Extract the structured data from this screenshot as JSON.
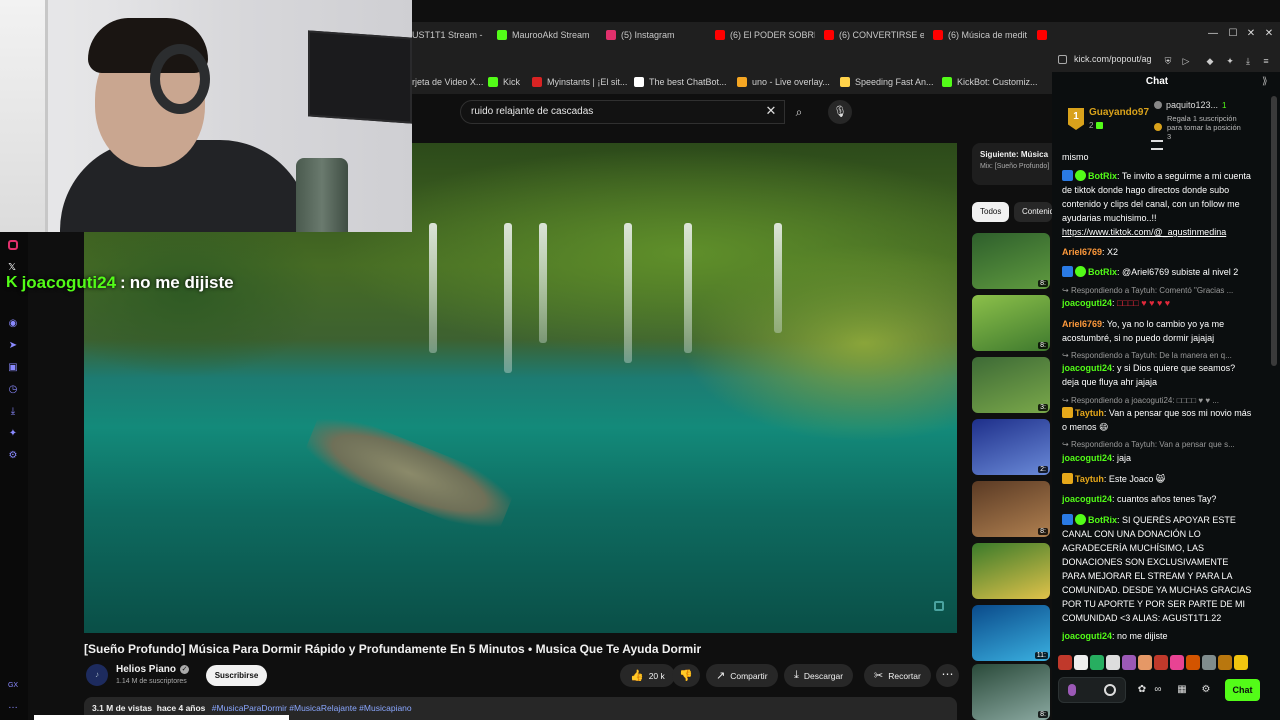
{
  "tabs": [
    {
      "label": "UST1T1 Stream - ",
      "color": "#53fc18"
    },
    {
      "label": "MaurooAkd Stream",
      "color": "#53fc18"
    },
    {
      "label": "(5) Instagram",
      "color": "#e1306c"
    },
    {
      "label": "(6) El PODER SOBRE",
      "color": "#ff0000"
    },
    {
      "label": "(6) CONVERTIRSE e",
      "color": "#ff0000"
    },
    {
      "label": "(6) Música de medit",
      "color": "#ff0000"
    }
  ],
  "bookmarks": [
    {
      "label": "rjeta de Video X...",
      "color": "#888888"
    },
    {
      "label": "Kick",
      "color": "#53fc18"
    },
    {
      "label": "Myinstants | ¡El sit...",
      "color": "#d92323"
    },
    {
      "label": "The best ChatBot...",
      "color": "#ffffff"
    },
    {
      "label": "uno - Live overlay...",
      "color": "#f5a623"
    },
    {
      "label": "Speeding Fast An...",
      "color": "#ffd24a"
    },
    {
      "label": "KickBot: Customiz...",
      "color": "#53fc18"
    }
  ],
  "chat_url": "kick.com/popout/ag",
  "search": {
    "query": "ruido relajante de cascadas"
  },
  "overlay": {
    "user": "joacoguti24",
    "sep": ":",
    "text": "no me dijiste"
  },
  "video": {
    "title": "[Sueño Profundo] Música Para Dormir Rápido y Profundamente En 5 Minutos • Musica Que Te Ayuda Dormir",
    "channel": "Helios Piano",
    "subscribers": "1.14 M de suscriptores",
    "subscribe_label": "Suscribirse",
    "likes": "20 k",
    "share_label": "Compartir",
    "download_label": "Descargar",
    "clip_label": "Recortar",
    "views": "3.1 M de vistas",
    "age": "hace 4 años",
    "tags": "#MusicaParaDormir #MusicaRelajante #Musicapiano"
  },
  "up_next": {
    "label": "Siguiente: Música",
    "sub": "Mix: [Sueño Profundo]"
  },
  "chips": {
    "all": "Todos",
    "content": "Contenido"
  },
  "thumbs": [
    {
      "dur": "8:",
      "color": "#3f7a3a"
    },
    {
      "dur": "8:",
      "color": "#6fae3b"
    },
    {
      "dur": "3:",
      "color": "#4a8a3e"
    },
    {
      "dur": "2:",
      "color": "#3a5bb8"
    },
    {
      "dur": "8:",
      "color": "#7a4a2e"
    },
    {
      "dur": "",
      "color": "#c9b64a"
    },
    {
      "dur": "11:",
      "color": "#1a7ab8"
    },
    {
      "dur": "8:",
      "color": "#4a6a5a"
    }
  ],
  "chat": {
    "title": "Chat",
    "top_gifter": {
      "rank": "1",
      "name": "Guayando97",
      "count": "2"
    },
    "pinned": {
      "user": "paquito123...",
      "num": "1",
      "desc": "Regala 1 suscripción para tomar la posición 3"
    },
    "send_label": "Chat",
    "messages": [
      {
        "kind": "text",
        "text": "mismo"
      },
      {
        "kind": "bot",
        "user": "BotRix",
        "text": "Te invito a seguirme a mi cuenta de tiktok donde hago directos donde subo contenido y clips del canal, con un follow me ayudarias muchisimo..!!",
        "link": "https://www.tiktok.com/@_agustinmedina"
      },
      {
        "kind": "user",
        "user": "Ariel6769",
        "color": "#ff9a3c",
        "text": "X2"
      },
      {
        "kind": "bot",
        "user": "BotRix",
        "text": "@Ariel6769 subiste al nivel 2"
      },
      {
        "kind": "reply",
        "text": "Respondiendo a Taytuh: Comentó \"Gracias ..."
      },
      {
        "kind": "user",
        "user": "joacoguti24",
        "color": "#53fc18",
        "text": "□□□□ ♥ ♥ ♥ ♥"
      },
      {
        "kind": "user",
        "user": "Ariel6769",
        "color": "#ff9a3c",
        "text": "Yo, ya no lo cambio yo ya me acostumbré, si no puedo dormir jajajaj"
      },
      {
        "kind": "reply",
        "text": "Respondiendo a Taytuh: De la manera en q..."
      },
      {
        "kind": "user",
        "user": "joacoguti24",
        "color": "#53fc18",
        "text": "y si Dios quiere que seamos? deja que fluya ahr jajaja"
      },
      {
        "kind": "reply",
        "text": "Respondiendo a joacoguti24: □□□□ ♥ ♥ ..."
      },
      {
        "kind": "crown",
        "user": "Taytuh",
        "color": "#e6a81a",
        "text": "Van a pensar que sos mi novio más o menos 😄"
      },
      {
        "kind": "reply",
        "text": "Respondiendo a Taytuh: Van a pensar que s..."
      },
      {
        "kind": "user",
        "user": "joacoguti24",
        "color": "#53fc18",
        "text": "jaja"
      },
      {
        "kind": "crown",
        "user": "Taytuh",
        "color": "#e6a81a",
        "text": "Este Joaco 😸"
      },
      {
        "kind": "user",
        "user": "joacoguti24",
        "color": "#53fc18",
        "text": "cuantos años tenes Tay?"
      },
      {
        "kind": "bot",
        "user": "BotRix",
        "text": "SI QUERÉS APOYAR ESTE CANAL CON UNA DONACIÓN LO AGRADECERÍA MUCHÍSIMO, LAS DONACIONES SON EXCLUSIVAMENTE PARA MEJORAR EL STREAM Y PARA LA COMUNIDAD. DESDE YA MUCHAS GRACIAS POR TU APORTE Y POR SER PARTE DE MI COMUNIDAD <3 ALIAS: AGUST1T1.22"
      },
      {
        "kind": "user",
        "user": "joacoguti24",
        "color": "#53fc18",
        "text": "no me dijiste"
      }
    ]
  },
  "colors": {
    "kick_green": "#53fc18",
    "bg": "#0f0f0f",
    "chat_bg": "#0b0e0f"
  }
}
